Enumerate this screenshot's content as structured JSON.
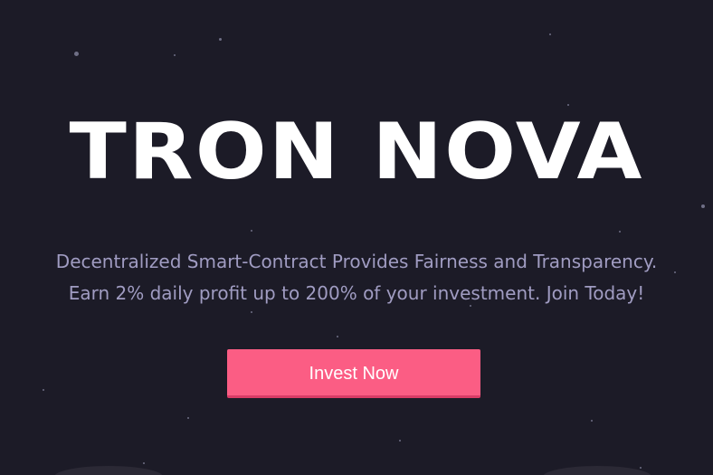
{
  "hero": {
    "title": "TRON NOVA",
    "tagline_line1": "Decentralized Smart-Contract Provides Fairness and Transparency.",
    "tagline_line2": "Earn 2% daily profit up to 200% of your investment. Join Today!",
    "cta_label": "Invest Now"
  },
  "colors": {
    "background": "#1c1b27",
    "title": "#ffffff",
    "tagline": "#a09cc2",
    "button": "#fb5d84",
    "button_shadow": "#d93c66",
    "stars": "#6f6f86"
  }
}
